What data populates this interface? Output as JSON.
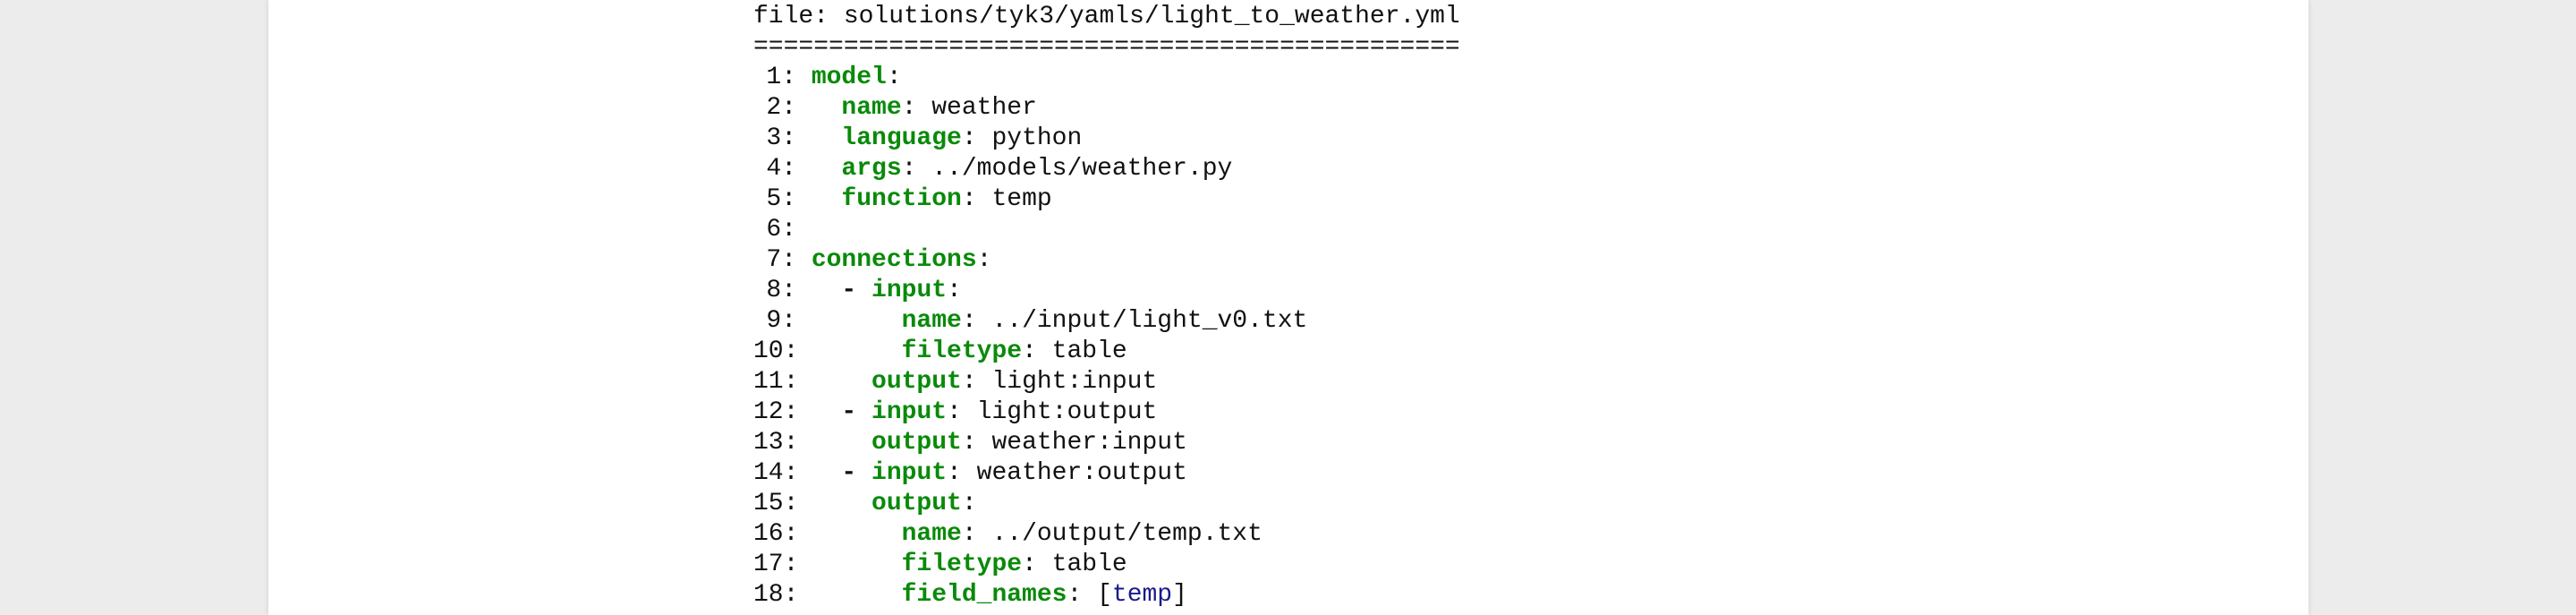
{
  "file_label": "file: solutions/tyk3/yamls/light_to_weather.yml",
  "separator": "===============================================",
  "colors": {
    "key": "#0a8a0a",
    "text": "#111111",
    "list_value": "#1a1a8a",
    "page_background": "#ffffff",
    "outer_background": "#ececec"
  },
  "lines": [
    {
      "num": "1:",
      "indent": "",
      "dash": "",
      "key": "model",
      "sep": ":",
      "value": "",
      "list": ""
    },
    {
      "num": "2:",
      "indent": "  ",
      "dash": "",
      "key": "name",
      "sep": ":",
      "value": " weather",
      "list": ""
    },
    {
      "num": "3:",
      "indent": "  ",
      "dash": "",
      "key": "language",
      "sep": ":",
      "value": " python",
      "list": ""
    },
    {
      "num": "4:",
      "indent": "  ",
      "dash": "",
      "key": "args",
      "sep": ":",
      "value": " ../models/weather.py",
      "list": ""
    },
    {
      "num": "5:",
      "indent": "  ",
      "dash": "",
      "key": "function",
      "sep": ":",
      "value": " temp",
      "list": ""
    },
    {
      "num": "6:",
      "indent": "",
      "dash": "",
      "key": "",
      "sep": "",
      "value": "",
      "list": ""
    },
    {
      "num": "7:",
      "indent": "",
      "dash": "",
      "key": "connections",
      "sep": ":",
      "value": "",
      "list": ""
    },
    {
      "num": "8:",
      "indent": "  ",
      "dash": "- ",
      "key": "input",
      "sep": ":",
      "value": "",
      "list": ""
    },
    {
      "num": "9:",
      "indent": "      ",
      "dash": "",
      "key": "name",
      "sep": ":",
      "value": " ../input/light_v0.txt",
      "list": ""
    },
    {
      "num": "10:",
      "indent": "      ",
      "dash": "",
      "key": "filetype",
      "sep": ":",
      "value": " table",
      "list": ""
    },
    {
      "num": "11:",
      "indent": "    ",
      "dash": "",
      "key": "output",
      "sep": ":",
      "value": " light:input",
      "list": ""
    },
    {
      "num": "12:",
      "indent": "  ",
      "dash": "- ",
      "key": "input",
      "sep": ":",
      "value": " light:output",
      "list": ""
    },
    {
      "num": "13:",
      "indent": "    ",
      "dash": "",
      "key": "output",
      "sep": ":",
      "value": " weather:input",
      "list": ""
    },
    {
      "num": "14:",
      "indent": "  ",
      "dash": "- ",
      "key": "input",
      "sep": ":",
      "value": " weather:output",
      "list": ""
    },
    {
      "num": "15:",
      "indent": "    ",
      "dash": "",
      "key": "output",
      "sep": ":",
      "value": "",
      "list": ""
    },
    {
      "num": "16:",
      "indent": "      ",
      "dash": "",
      "key": "name",
      "sep": ":",
      "value": " ../output/temp.txt",
      "list": ""
    },
    {
      "num": "17:",
      "indent": "      ",
      "dash": "",
      "key": "filetype",
      "sep": ":",
      "value": " table",
      "list": ""
    },
    {
      "num": "18:",
      "indent": "      ",
      "dash": "",
      "key": "field_names",
      "sep": ":",
      "value": " [",
      "list": "temp",
      "value_end": "]"
    }
  ]
}
